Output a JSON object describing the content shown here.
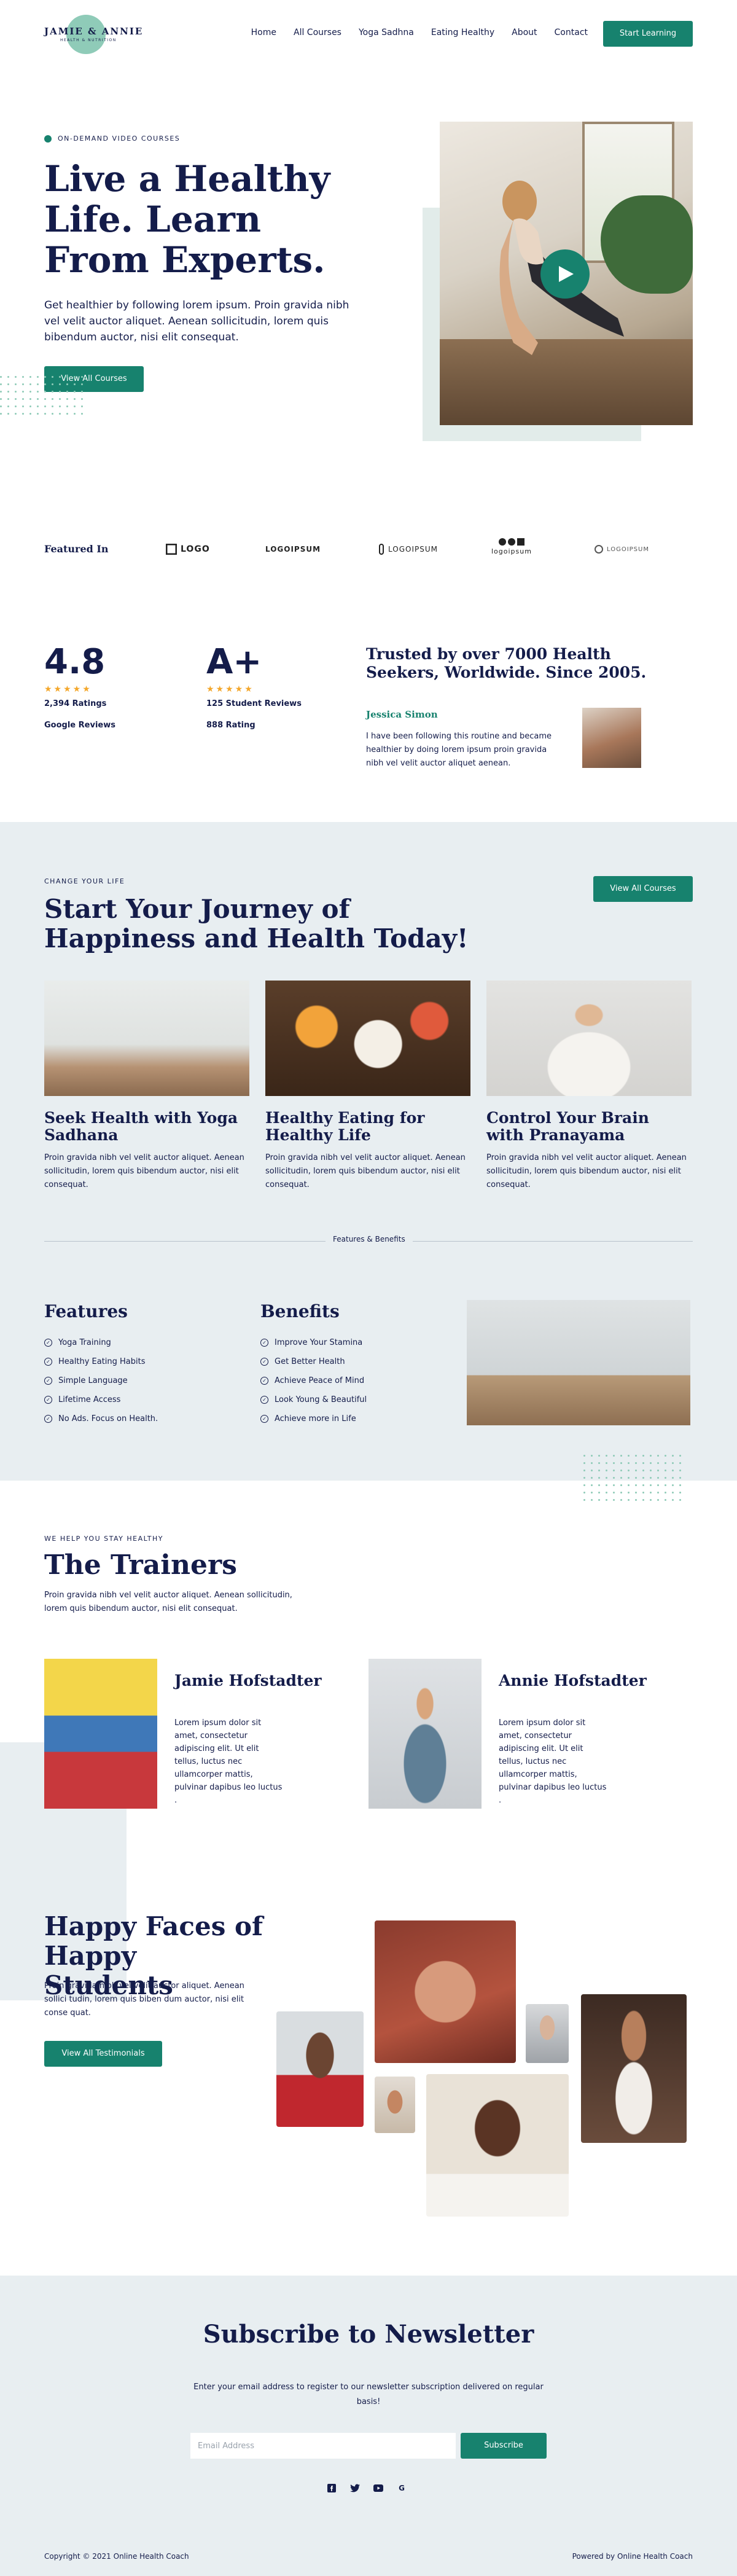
{
  "brand": {
    "name": "JAMIE & ANNIE",
    "tagline": "HEALTH & NUTRITION"
  },
  "nav": {
    "items": [
      "Home",
      "All Courses",
      "Yoga Sadhna",
      "Eating Healthy",
      "About",
      "Contact"
    ],
    "cta": "Start Learning"
  },
  "hero": {
    "eyebrow": "ON-DEMAND VIDEO COURSES",
    "title": "Live a Healthy Life. Learn From Experts.",
    "text": "Get healthier by following lorem ipsum. Proin gravida nibh vel velit auctor aliquet. Aenean sollicitudin, lorem quis bibendum auctor, nisi elit consequat.",
    "button": "View All Courses"
  },
  "featured": {
    "label": "Featured In",
    "logos": [
      "LOGO",
      "LOGOIPSUM",
      "LOGOIPSUM",
      "logoipsum",
      "LOGOIPSUM"
    ]
  },
  "ratings": [
    {
      "value": "4.8",
      "stars": "★★★★★",
      "line1": "2,394 Ratings",
      "line2": "Google Reviews"
    },
    {
      "value": "A+",
      "stars": "★★★★★",
      "line1": "125 Student Reviews",
      "line2": "888 Rating"
    }
  ],
  "testimonial": {
    "heading": "Trusted by over 7000 Health Seekers, Worldwide. Since 2005.",
    "name": "Jessica Simon",
    "text": "I have been following this routine and became healthier by doing lorem ipsum proin gravida nibh vel velit auctor aliquet aenean."
  },
  "journey": {
    "eyebrow": "CHANGE YOUR LIFE",
    "title": "Start Your Journey of Happiness and Health Today!",
    "button": "View All Courses",
    "cards": [
      {
        "title": "Seek Health with Yoga Sadhana",
        "text": "Proin gravida nibh vel velit auctor aliquet. Aenean sollicitudin, lorem quis bibendum auctor, nisi elit consequat."
      },
      {
        "title": "Healthy Eating for Healthy Life",
        "text": "Proin gravida nibh vel velit auctor aliquet. Aenean sollicitudin, lorem quis bibendum auctor, nisi elit consequat."
      },
      {
        "title": "Control Your Brain with Pranayama",
        "text": "Proin gravida nibh vel velit auctor aliquet. Aenean sollicitudin, lorem quis bibendum auctor, nisi elit consequat."
      }
    ],
    "divider": "Features & Benefits",
    "features": {
      "title": "Features",
      "items": [
        "Yoga Training",
        "Healthy Eating Habits",
        "Simple Language",
        "Lifetime Access",
        "No Ads. Focus on Health."
      ]
    },
    "benefits": {
      "title": "Benefits",
      "items": [
        "Improve Your Stamina",
        "Get Better Health",
        "Achieve Peace of Mind",
        "Look Young & Beautiful",
        "Achieve more in Life"
      ]
    }
  },
  "trainers": {
    "eyebrow": "WE HELP YOU STAY HEALTHY",
    "title": "The Trainers",
    "text": "Proin gravida nibh vel velit auctor aliquet. Aenean sollicitudin, lorem quis bibendum auctor, nisi elit consequat.",
    "people": [
      {
        "name": "Jamie Hofstadter",
        "bio": "Lorem ipsum dolor sit amet, consectetur adipiscing elit. Ut elit tellus, luctus nec ullamcorper mattis, pulvinar dapibus leo luctus ."
      },
      {
        "name": "Annie Hofstadter",
        "bio": "Lorem ipsum dolor sit amet, consectetur adipiscing elit. Ut elit tellus, luctus nec ullamcorper mattis, pulvinar dapibus leo luctus ."
      }
    ]
  },
  "happy": {
    "title": "Happy Faces of Happy Students",
    "text": "Proin gravida nibh vel velit auctor aliquet. Aenean sollici tudin, lorem quis biben dum auctor, nisi elit conse quat.",
    "button": "View All Testimonials"
  },
  "newsletter": {
    "title": "Subscribe to Newsletter",
    "text": "Enter your email address to register to our newsletter subscription delivered on regular basis!",
    "placeholder": "Email Address",
    "button": "Subscribe",
    "social": [
      "facebook-icon",
      "twitter-icon",
      "youtube-icon",
      "google-icon"
    ]
  },
  "footer": {
    "copyright": "Copyright © 2021 Online Health Coach",
    "powered": "Powered by Online Health Coach"
  },
  "colors": {
    "accent": "#17826e",
    "navy": "#141c4a",
    "band": "#e8eef1",
    "star": "#f4a72b"
  }
}
